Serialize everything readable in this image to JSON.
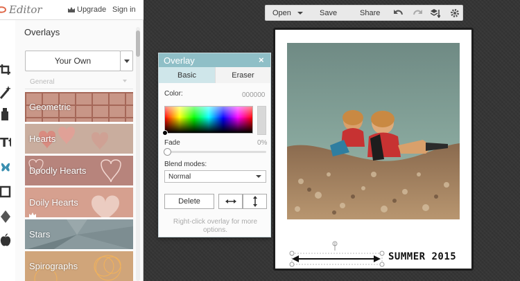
{
  "app": {
    "logo_text": "Editor",
    "upgrade_label": "Upgrade",
    "signin_label": "Sign in"
  },
  "panel": {
    "title": "Overlays",
    "dropdown_value": "Your Own",
    "category": "General",
    "tiles": [
      {
        "label": "Geometric",
        "premium": false
      },
      {
        "label": "Hearts",
        "premium": false
      },
      {
        "label": "Doodly Hearts",
        "premium": false
      },
      {
        "label": "Doily Hearts",
        "premium": true
      },
      {
        "label": "Stars",
        "premium": false
      },
      {
        "label": "Spirographs",
        "premium": false
      }
    ]
  },
  "toolbar": {
    "open_label": "Open",
    "save_label": "Save",
    "share_label": "Share",
    "icons": [
      "undo-icon",
      "redo-icon",
      "layers-icon",
      "settings-icon"
    ]
  },
  "dialog": {
    "title": "Overlay",
    "close_glyph": "×",
    "tabs": [
      "Basic",
      "Eraser"
    ],
    "color_label": "Color:",
    "color_value": "000000",
    "fade_label": "Fade",
    "fade_value": "0%",
    "fade_level": 0,
    "blend_label": "Blend modes:",
    "blend_value": "Normal",
    "delete_label": "Delete",
    "help_text": "Right-click overlay for more options."
  },
  "canvas": {
    "caption": "SUMMER 2015"
  },
  "colors": {
    "accent": "#8fbfc7",
    "tab_active": "#cfe6ea"
  }
}
